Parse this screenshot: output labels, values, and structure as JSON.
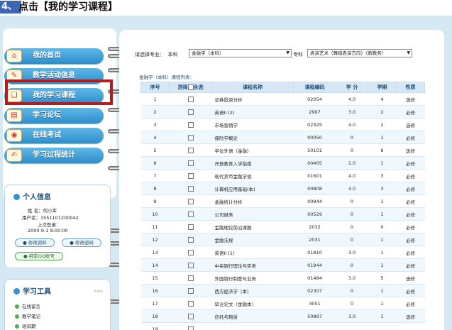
{
  "step": {
    "number": "4、",
    "text": "点击【我的学习课程】"
  },
  "nav": [
    {
      "label": "我的首页"
    },
    {
      "label": "教学活动信息"
    },
    {
      "label": "我的学习课程"
    },
    {
      "label": "学习论坛"
    },
    {
      "label": "在线考试"
    },
    {
      "label": "学习过程统计"
    }
  ],
  "personal_info": {
    "title": "个人信息",
    "name_line": "姓  名：何小军",
    "user_line": "用户名：1551101200042",
    "last_login_label": "上次登录：",
    "last_login_value": "2000-9-1 8:00:00",
    "edit_profile": "修改资料",
    "edit_password": "修改密码",
    "bind_qq": "绑定QQ帐号"
  },
  "tools": {
    "title": "学习工具",
    "more": "more",
    "items": [
      "在线留言",
      "教学笔记",
      "培训期"
    ]
  },
  "filter": {
    "label": "请选择专业：",
    "level1": "本科",
    "major1": "金融学（本科）",
    "level2": "专科",
    "major2": "表演艺术（舞蹈表演方向）（新教务）"
  },
  "list_title": "金融学（本科）课程列表：",
  "table": {
    "headers": {
      "no": "序号",
      "select": "选择",
      "select_all": "全选",
      "name": "课程名称",
      "code": "课程编码",
      "credit": "学  分",
      "term": "学期",
      "type": "性质"
    },
    "rows": [
      {
        "no": "1",
        "name": "证券投资分析",
        "code": "02054",
        "credit": "4.0",
        "term": "4",
        "type": "选修"
      },
      {
        "no": "2",
        "name": "英语II (2)",
        "code": "2907",
        "credit": "3.0",
        "term": "2",
        "type": "必修"
      },
      {
        "no": "3",
        "name": "市场营销学",
        "code": "02325",
        "credit": "4.0",
        "term": "2",
        "type": "选修"
      },
      {
        "no": "4",
        "name": "保险学概论",
        "code": "00050",
        "credit": "0",
        "term": "1",
        "type": "必修"
      },
      {
        "no": "5",
        "name": "学位外语（金融）",
        "code": "50101",
        "credit": "0",
        "term": "6",
        "type": "选修"
      },
      {
        "no": "6",
        "name": "开放教育入学指南",
        "code": "00405",
        "credit": "1.0",
        "term": "1",
        "type": "必修"
      },
      {
        "no": "7",
        "name": "现代货币金融学说",
        "code": "01601",
        "credit": "4.0",
        "term": "3",
        "type": "必修"
      },
      {
        "no": "8",
        "name": "计算机应用基础(本)",
        "code": "00808",
        "credit": "4.0",
        "term": "3",
        "type": "必修"
      },
      {
        "no": "9",
        "name": "金融统计分析",
        "code": "00944",
        "credit": "0",
        "term": "1",
        "type": "必修"
      },
      {
        "no": "10",
        "name": "公司财务",
        "code": "00529",
        "credit": "0",
        "term": "1",
        "type": "必修"
      },
      {
        "no": "11",
        "name": "金融理论前沿课题",
        "code": "2032",
        "credit": "0",
        "term": "0",
        "type": "必修"
      },
      {
        "no": "12",
        "name": "金融法规",
        "code": "2031",
        "credit": "0",
        "term": "1",
        "type": "必修"
      },
      {
        "no": "13",
        "name": "英语II (1)",
        "code": "01810",
        "credit": "3.0",
        "term": "1",
        "type": "必修"
      },
      {
        "no": "14",
        "name": "中央银行理论与实务",
        "code": "01944",
        "credit": "0",
        "term": "1",
        "type": "必修"
      },
      {
        "no": "15",
        "name": "外国银行制度与业务",
        "code": "01484",
        "credit": "3.0",
        "term": "5",
        "type": "选修"
      },
      {
        "no": "16",
        "name": "西方经济学（本）",
        "code": "02307",
        "credit": "0",
        "term": "1",
        "type": "必修"
      },
      {
        "no": "17",
        "name": "毕业论文（金融本）",
        "code": "3051",
        "credit": "0",
        "term": "1",
        "type": "必修"
      },
      {
        "no": "18",
        "name": "信托与租赁",
        "code": "50897",
        "credit": "3.0",
        "term": "1",
        "type": "选修"
      },
      {
        "no": "19",
        "name": "",
        "code": "",
        "credit": "",
        "term": "",
        "type": ""
      }
    ]
  }
}
